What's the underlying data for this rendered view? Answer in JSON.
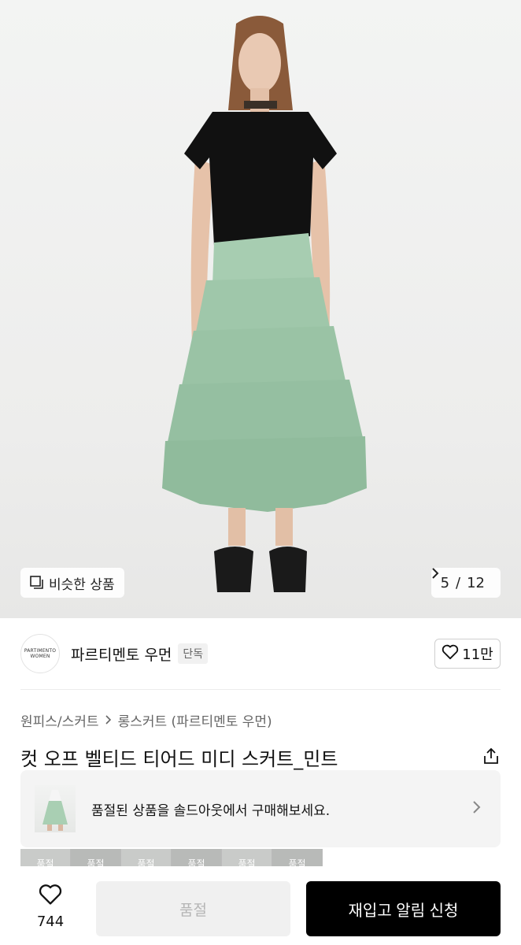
{
  "hero": {
    "similar_label": "비슷한 상품",
    "page_current": "5",
    "page_separator": "/",
    "page_total": "12"
  },
  "brand": {
    "logo_line1": "PARTIMENTO",
    "logo_line2": "WOMEN",
    "name": "파르티멘토 우먼",
    "badge": "단독",
    "like_count": "11만"
  },
  "breadcrumb": {
    "category": "원피스/스커트",
    "subcategory": "롱스커트 (파르티멘토 우먼)"
  },
  "product": {
    "title": "컷 오프 벨티드 티어드 미디 스커트_민트"
  },
  "soldout_banner": {
    "text": "품절된 상품을 솔드아웃에서 구매해보세요."
  },
  "thumb_strip": [
    "품절",
    "품절",
    "품절",
    "품절",
    "품절",
    "품절"
  ],
  "bottom_bar": {
    "wish_count": "744",
    "soldout_label": "품절",
    "restock_label": "재입고 알림 신청"
  },
  "colors": {
    "skirt": "#9cc4a7",
    "top": "#111111",
    "accent": "#000000"
  }
}
